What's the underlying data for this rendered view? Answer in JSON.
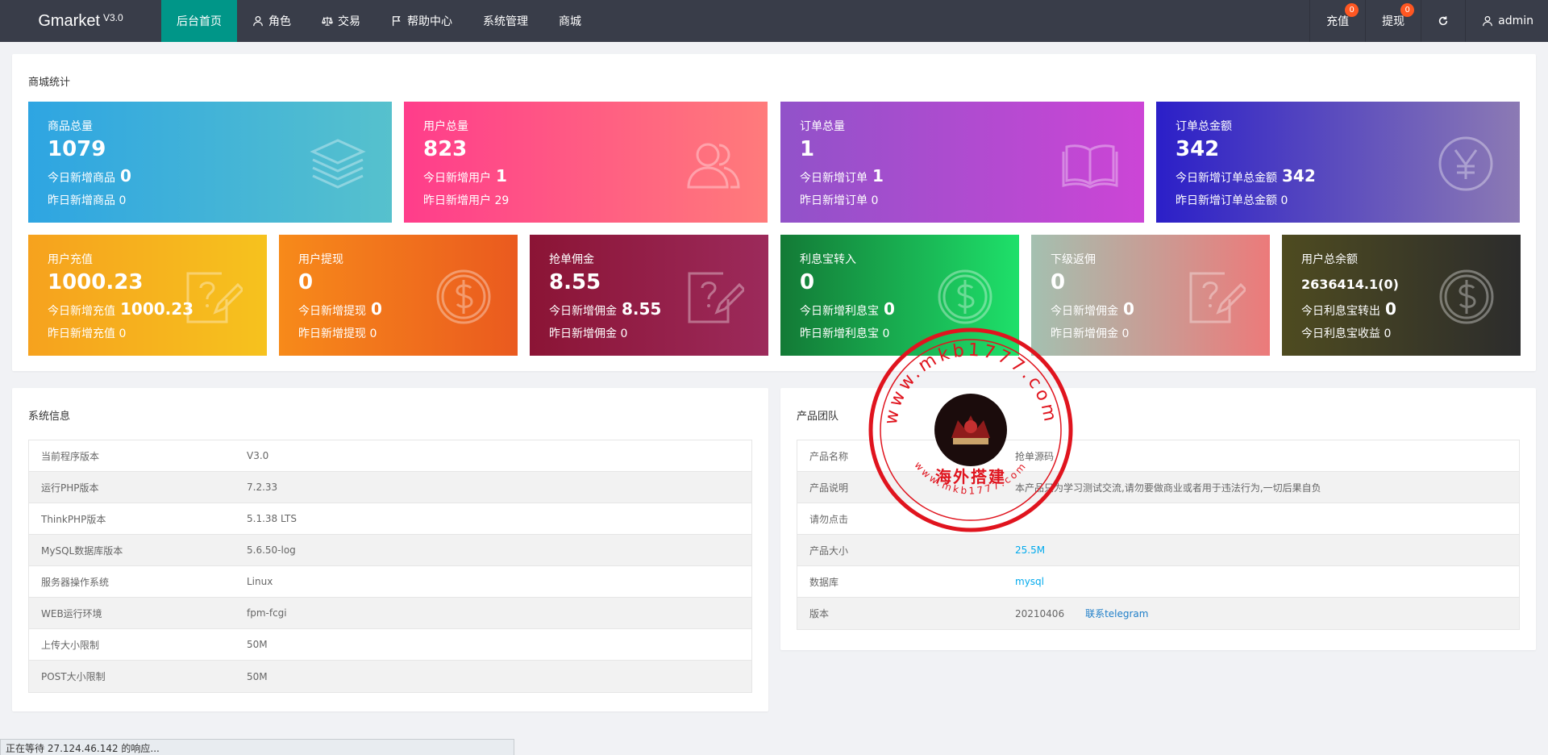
{
  "app": {
    "name": "Gmarket",
    "version": "V3.0"
  },
  "nav": {
    "items": [
      {
        "label": "后台首页",
        "icon": ""
      },
      {
        "label": "角色",
        "icon": "user-icon"
      },
      {
        "label": "交易",
        "icon": "scale-icon"
      },
      {
        "label": "帮助中心",
        "icon": "flag-icon"
      },
      {
        "label": "系统管理",
        "icon": ""
      },
      {
        "label": "商城",
        "icon": ""
      }
    ],
    "right": {
      "recharge": {
        "label": "充值",
        "badge": "0"
      },
      "withdraw": {
        "label": "提现",
        "badge": "0"
      },
      "refresh_icon": "refresh-icon",
      "user": "admin"
    }
  },
  "stats": {
    "title": "商城统计",
    "row1": [
      {
        "title": "商品总量",
        "total": "1079",
        "today_label": "今日新增商品",
        "today": "0",
        "yest_label": "昨日新增商品",
        "yest": "0",
        "icon": "layers-icon",
        "grad": "linear-gradient(90deg,#2ea5e2,#56c1cd)"
      },
      {
        "title": "用户总量",
        "total": "823",
        "today_label": "今日新增用户",
        "today": "1",
        "yest_label": "昨日新增用户",
        "yest": "29",
        "icon": "users-icon",
        "grad": "linear-gradient(90deg,#ff3d8b,#ff7b7b)"
      },
      {
        "title": "订单总量",
        "total": "1",
        "today_label": "今日新增订单",
        "today": "1",
        "yest_label": "昨日新增订单",
        "yest": "0",
        "icon": "book-icon",
        "grad": "linear-gradient(90deg,#9152c9,#cc45d6)"
      },
      {
        "title": "订单总金额",
        "total": "342",
        "today_label": "今日新增订单总金额",
        "today": "342",
        "yest_label": "昨日新增订单总金额",
        "yest": "0",
        "icon": "yen-icon",
        "grad": "linear-gradient(90deg,#2b1fc8,#8c7ab4)"
      }
    ],
    "row2": [
      {
        "title": "用户充值",
        "total": "1000.23",
        "today_label": "今日新增充值",
        "today": "1000.23",
        "yest_label": "昨日新增充值",
        "yest": "0",
        "icon": "question-edit-icon",
        "grad": "linear-gradient(90deg,#f6a21e,#f6c21e)"
      },
      {
        "title": "用户提现",
        "total": "0",
        "today_label": "今日新增提现",
        "today": "0",
        "yest_label": "昨日新增提现",
        "yest": "0",
        "icon": "dollar-icon",
        "grad": "linear-gradient(90deg,#f78a1a,#ea5a1f)"
      },
      {
        "title": "抢单佣金",
        "total": "8.55",
        "today_label": "今日新增佣金",
        "today": "8.55",
        "yest_label": "昨日新增佣金",
        "yest": "0",
        "icon": "question-edit-icon",
        "grad": "linear-gradient(90deg,#8b1435,#9c2a5b)"
      },
      {
        "title": "利息宝转入",
        "total": "0",
        "today_label": "今日新增利息宝",
        "today": "0",
        "yest_label": "昨日新增利息宝",
        "yest": "0",
        "icon": "dollar-icon",
        "grad": "linear-gradient(90deg,#137a36,#1ee06a)"
      },
      {
        "title": "下级返佣",
        "total": "0",
        "today_label": "今日新增佣金",
        "today": "0",
        "yest_label": "昨日新增佣金",
        "yest": "0",
        "icon": "question-edit-icon",
        "grad": "linear-gradient(90deg,#a4c0b0,#ec7a7a)"
      },
      {
        "title": "用户总余额",
        "total": "2636414.1(0)",
        "today_label": "今日利息宝转出",
        "today": "0",
        "yest_label": "今日利息宝收益",
        "yest": "0",
        "icon": "dollar-icon",
        "grad": "linear-gradient(90deg,#4e4b20,#2c2c2c)"
      }
    ]
  },
  "sysinfo": {
    "title": "系统信息",
    "rows": [
      {
        "k": "当前程序版本",
        "v": "V3.0"
      },
      {
        "k": "运行PHP版本",
        "v": "7.2.33"
      },
      {
        "k": "ThinkPHP版本",
        "v": "5.1.38 LTS"
      },
      {
        "k": "MySQL数据库版本",
        "v": "5.6.50-log"
      },
      {
        "k": "服务器操作系统",
        "v": "Linux"
      },
      {
        "k": "WEB运行环境",
        "v": "fpm-fcgi"
      },
      {
        "k": "上传大小限制",
        "v": "50M"
      },
      {
        "k": "POST大小限制",
        "v": "50M"
      }
    ]
  },
  "team": {
    "title": "产品团队",
    "rows": [
      {
        "k": "产品名称",
        "v": "抢单源码"
      },
      {
        "k": "产品说明",
        "v": "本产品只为学习测试交流,请勿要做商业或者用于违法行为,一切后果自负"
      },
      {
        "k": "请勿点击",
        "v": ""
      },
      {
        "k": "产品大小",
        "v": "25.5M"
      },
      {
        "k": "数据库",
        "v": "mysql"
      },
      {
        "k": "版本",
        "v": "20210406",
        "link": "联系telegram"
      }
    ]
  },
  "watermark": {
    "top_text": "www.mkb1777.com",
    "center_text": "海外搭建",
    "bottom_text": "www.mkb1777.com",
    "color": "#e0141e"
  },
  "statusbar": "正在等待 27.124.46.142 的响应..."
}
